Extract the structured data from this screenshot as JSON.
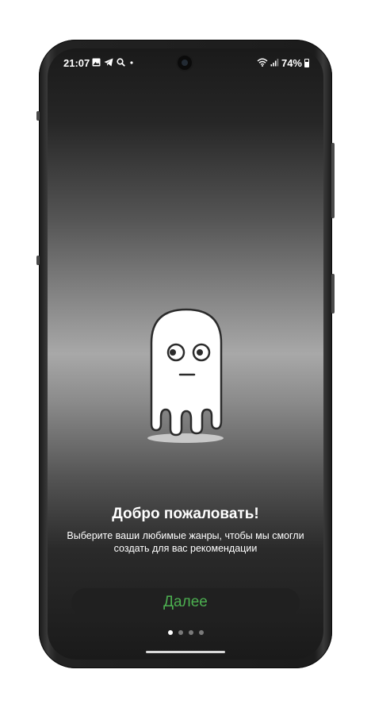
{
  "status_bar": {
    "time": "21:07",
    "left_icons": [
      "gallery-icon",
      "telegram-icon",
      "search-icon",
      "dot-icon"
    ],
    "right_icons": [
      "wifi-icon",
      "signal-icon"
    ],
    "battery_percent": "74%"
  },
  "welcome": {
    "title": "Добро пожаловать!",
    "subtitle": "Выберите ваши любимые жанры, чтобы мы смогли создать для вас рекомендации"
  },
  "actions": {
    "next_label": "Далее"
  },
  "pagination": {
    "total": 4,
    "active_index": 0
  },
  "colors": {
    "accent": "#4caf50",
    "button_bg": "#202020",
    "text": "#ffffff"
  }
}
